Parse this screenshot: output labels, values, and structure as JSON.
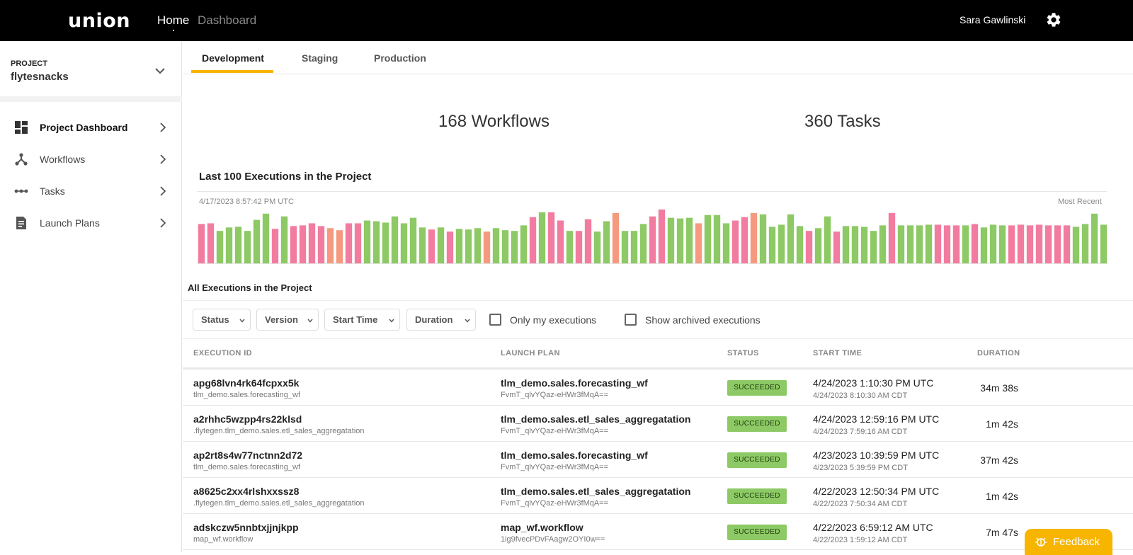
{
  "topbar": {
    "logo": "union",
    "nav_home": "Home",
    "nav_dashboard": "Dashboard",
    "user_name": "Sara Gawlinski",
    "settings_icon": "gear-icon"
  },
  "sidebar": {
    "project_label": "PROJECT",
    "project_name": "flytesnacks",
    "items": [
      {
        "label": "Project Dashboard",
        "icon": "dashboard-grid-icon",
        "active": true
      },
      {
        "label": "Workflows",
        "icon": "workflow-graph-icon",
        "active": false
      },
      {
        "label": "Tasks",
        "icon": "tasks-dots-icon",
        "active": false
      },
      {
        "label": "Launch Plans",
        "icon": "document-icon",
        "active": false
      }
    ]
  },
  "tabs": [
    {
      "label": "Development",
      "active": true
    },
    {
      "label": "Staging",
      "active": false
    },
    {
      "label": "Production",
      "active": false
    }
  ],
  "stats": {
    "workflows": "168 Workflows",
    "tasks": "360 Tasks"
  },
  "executions_chart": {
    "title": "Last 100 Executions in the Project",
    "start_label": "4/17/2023 8:57:42 PM UTC",
    "end_label": "Most Recent",
    "colors": {
      "succeeded": "#8dc964",
      "failed": "#f27ca0",
      "aborted": "#f59a7e"
    },
    "chart_data": {
      "type": "bar",
      "title": "Last 100 Executions in the Project",
      "xlabel": "",
      "ylabel": "",
      "bars": [
        {
          "status": "failed",
          "value": 57
        },
        {
          "status": "failed",
          "value": 58
        },
        {
          "status": "succeeded",
          "value": 47
        },
        {
          "status": "succeeded",
          "value": 52
        },
        {
          "status": "succeeded",
          "value": 53
        },
        {
          "status": "succeeded",
          "value": 47
        },
        {
          "status": "succeeded",
          "value": 63
        },
        {
          "status": "succeeded",
          "value": 72
        },
        {
          "status": "failed",
          "value": 50
        },
        {
          "status": "succeeded",
          "value": 68
        },
        {
          "status": "failed",
          "value": 54
        },
        {
          "status": "failed",
          "value": 55
        },
        {
          "status": "failed",
          "value": 58
        },
        {
          "status": "failed",
          "value": 54
        },
        {
          "status": "aborted",
          "value": 51
        },
        {
          "status": "aborted",
          "value": 48
        },
        {
          "status": "failed",
          "value": 58
        },
        {
          "status": "failed",
          "value": 58
        },
        {
          "status": "succeeded",
          "value": 62
        },
        {
          "status": "succeeded",
          "value": 61
        },
        {
          "status": "succeeded",
          "value": 59
        },
        {
          "status": "succeeded",
          "value": 68
        },
        {
          "status": "succeeded",
          "value": 58
        },
        {
          "status": "succeeded",
          "value": 66
        },
        {
          "status": "succeeded",
          "value": 52
        },
        {
          "status": "failed",
          "value": 49
        },
        {
          "status": "succeeded",
          "value": 52
        },
        {
          "status": "failed",
          "value": 46
        },
        {
          "status": "succeeded",
          "value": 50
        },
        {
          "status": "succeeded",
          "value": 49
        },
        {
          "status": "succeeded",
          "value": 51
        },
        {
          "status": "aborted",
          "value": 46
        },
        {
          "status": "succeeded",
          "value": 51
        },
        {
          "status": "succeeded",
          "value": 48
        },
        {
          "status": "succeeded",
          "value": 47
        },
        {
          "status": "succeeded",
          "value": 55
        },
        {
          "status": "failed",
          "value": 67
        },
        {
          "status": "succeeded",
          "value": 74
        },
        {
          "status": "failed",
          "value": 74
        },
        {
          "status": "failed",
          "value": 62
        },
        {
          "status": "succeeded",
          "value": 47
        },
        {
          "status": "failed",
          "value": 47
        },
        {
          "status": "failed",
          "value": 64
        },
        {
          "status": "succeeded",
          "value": 46
        },
        {
          "status": "succeeded",
          "value": 61
        },
        {
          "status": "aborted",
          "value": 73
        },
        {
          "status": "succeeded",
          "value": 47
        },
        {
          "status": "succeeded",
          "value": 47
        },
        {
          "status": "succeeded",
          "value": 57
        },
        {
          "status": "failed",
          "value": 68
        },
        {
          "status": "failed",
          "value": 78
        },
        {
          "status": "succeeded",
          "value": 66
        },
        {
          "status": "succeeded",
          "value": 65
        },
        {
          "status": "succeeded",
          "value": 66
        },
        {
          "status": "aborted",
          "value": 58
        },
        {
          "status": "succeeded",
          "value": 70
        },
        {
          "status": "succeeded",
          "value": 70
        },
        {
          "status": "succeeded",
          "value": 58
        },
        {
          "status": "failed",
          "value": 62
        },
        {
          "status": "failed",
          "value": 67
        },
        {
          "status": "aborted",
          "value": 73
        },
        {
          "status": "succeeded",
          "value": 71
        },
        {
          "status": "succeeded",
          "value": 53
        },
        {
          "status": "succeeded",
          "value": 56
        },
        {
          "status": "succeeded",
          "value": 71
        },
        {
          "status": "succeeded",
          "value": 54
        },
        {
          "status": "failed",
          "value": 47
        },
        {
          "status": "succeeded",
          "value": 51
        },
        {
          "status": "succeeded",
          "value": 68
        },
        {
          "status": "failed",
          "value": 46
        },
        {
          "status": "succeeded",
          "value": 54
        },
        {
          "status": "succeeded",
          "value": 54
        },
        {
          "status": "succeeded",
          "value": 53
        },
        {
          "status": "succeeded",
          "value": 47
        },
        {
          "status": "succeeded",
          "value": 55
        },
        {
          "status": "failed",
          "value": 73
        },
        {
          "status": "succeeded",
          "value": 55
        },
        {
          "status": "succeeded",
          "value": 55
        },
        {
          "status": "succeeded",
          "value": 55
        },
        {
          "status": "succeeded",
          "value": 56
        },
        {
          "status": "failed",
          "value": 56
        },
        {
          "status": "failed",
          "value": 55
        },
        {
          "status": "failed",
          "value": 55
        },
        {
          "status": "succeeded",
          "value": 55
        },
        {
          "status": "failed",
          "value": 57
        },
        {
          "status": "succeeded",
          "value": 52
        },
        {
          "status": "succeeded",
          "value": 56
        },
        {
          "status": "succeeded",
          "value": 55
        },
        {
          "status": "failed",
          "value": 55
        },
        {
          "status": "failed",
          "value": 56
        },
        {
          "status": "failed",
          "value": 55
        },
        {
          "status": "failed",
          "value": 56
        },
        {
          "status": "failed",
          "value": 55
        },
        {
          "status": "failed",
          "value": 55
        },
        {
          "status": "failed",
          "value": 55
        },
        {
          "status": "succeeded",
          "value": 53
        },
        {
          "status": "succeeded",
          "value": 57
        },
        {
          "status": "succeeded",
          "value": 72
        },
        {
          "status": "succeeded",
          "value": 56
        }
      ]
    }
  },
  "executions": {
    "section_title": "All Executions in the Project",
    "filters": [
      "Status",
      "Version",
      "Start Time",
      "Duration"
    ],
    "checkboxes": [
      "Only my executions",
      "Show archived executions"
    ],
    "columns": [
      "EXECUTION ID",
      "LAUNCH PLAN",
      "STATUS",
      "START TIME",
      "DURATION"
    ],
    "rows": [
      {
        "id": "apg68lvn4rk64fcpxx5k",
        "id_sub": "tlm_demo.sales.forecasting_wf",
        "plan": "tlm_demo.sales.forecasting_wf",
        "plan_sub": "FvmT_qlvYQaz-eHWr3fMqA==",
        "status": "SUCCEEDED",
        "start": "4/24/2023 1:10:30 PM UTC",
        "start_sub": "4/24/2023 8:10:30 AM CDT",
        "duration": "34m 38s"
      },
      {
        "id": "a2rhhc5wzpp4rs22klsd",
        "id_sub": ".flytegen.tlm_demo.sales.etl_sales_aggregatation",
        "plan": "tlm_demo.sales.etl_sales_aggregatation",
        "plan_sub": "FvmT_qlvYQaz-eHWr3fMqA==",
        "status": "SUCCEEDED",
        "start": "4/24/2023 12:59:16 PM UTC",
        "start_sub": "4/24/2023 7:59:16 AM CDT",
        "duration": "1m 42s"
      },
      {
        "id": "ap2rt8s4w77nctnn2d72",
        "id_sub": "tlm_demo.sales.forecasting_wf",
        "plan": "tlm_demo.sales.forecasting_wf",
        "plan_sub": "FvmT_qlvYQaz-eHWr3fMqA==",
        "status": "SUCCEEDED",
        "start": "4/23/2023 10:39:59 PM UTC",
        "start_sub": "4/23/2023 5:39:59 PM CDT",
        "duration": "37m 42s"
      },
      {
        "id": "a8625c2xx4rlshxxssz8",
        "id_sub": ".flytegen.tlm_demo.sales.etl_sales_aggregatation",
        "plan": "tlm_demo.sales.etl_sales_aggregatation",
        "plan_sub": "FvmT_qlvYQaz-eHWr3fMqA==",
        "status": "SUCCEEDED",
        "start": "4/22/2023 12:50:34 PM UTC",
        "start_sub": "4/22/2023 7:50:34 AM CDT",
        "duration": "1m 42s"
      },
      {
        "id": "adskczw5nnbtxjjnjkpp",
        "id_sub": "map_wf.workflow",
        "plan": "map_wf.workflow",
        "plan_sub": "1ig9fvecPDvFAagw2OYI0w==",
        "status": "SUCCEEDED",
        "start": "4/22/2023 6:59:12 AM UTC",
        "start_sub": "4/22/2023 1:59:12 AM CDT",
        "duration": "7m 47s"
      }
    ]
  },
  "feedback": {
    "label": "Feedback",
    "icon": "bug-icon"
  }
}
